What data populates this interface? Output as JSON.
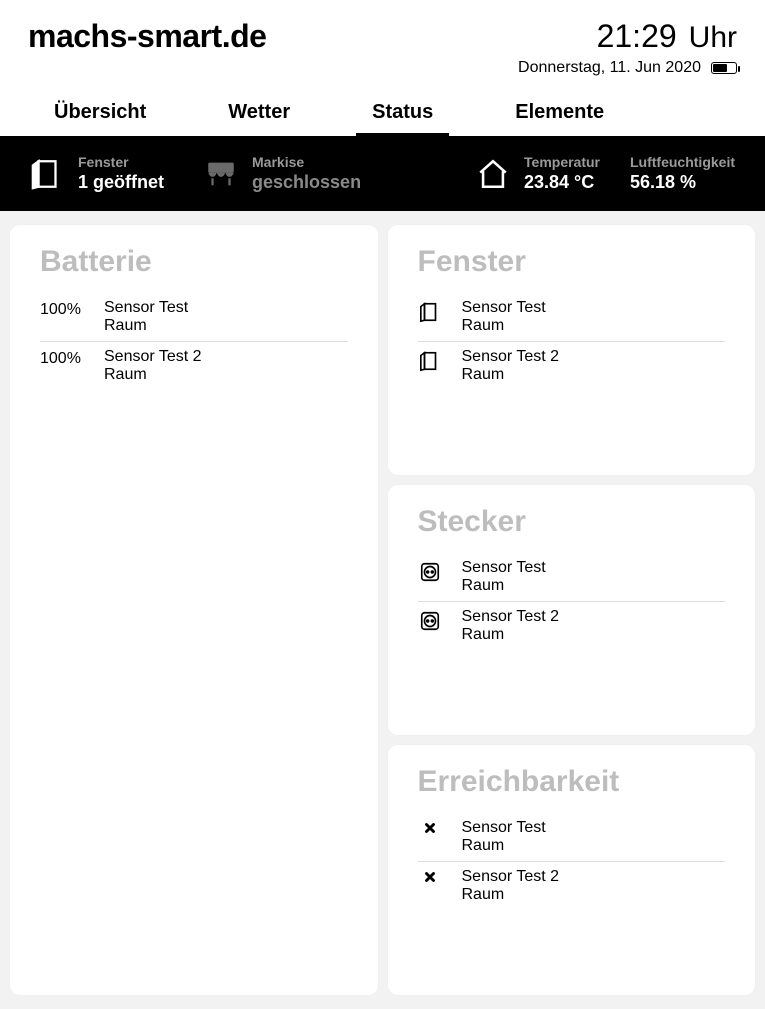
{
  "header": {
    "site_title": "machs-smart.de",
    "time": "21:29",
    "time_suffix": "Uhr",
    "date": "Donnerstag, 11. Jun 2020"
  },
  "tabs": [
    {
      "label": "Übersicht",
      "active": false
    },
    {
      "label": "Wetter",
      "active": false
    },
    {
      "label": "Status",
      "active": true
    },
    {
      "label": "Elemente",
      "active": false
    }
  ],
  "statusbar": {
    "fenster": {
      "label": "Fenster",
      "value": "1 geöffnet"
    },
    "markise": {
      "label": "Markise",
      "value": "geschlossen"
    },
    "temperatur": {
      "label": "Temperatur",
      "value": "23.84 °C"
    },
    "luftfeuchtigkeit": {
      "label": "Luftfeuchtigkeit",
      "value": "56.18 %"
    }
  },
  "cards": {
    "fenster": {
      "title": "Fenster",
      "rows": [
        {
          "name": "Sensor Test",
          "room": "Raum"
        },
        {
          "name": "Sensor Test 2",
          "room": "Raum"
        }
      ]
    },
    "batterie": {
      "title": "Batterie",
      "rows": [
        {
          "value": "100%",
          "name": "Sensor Test",
          "room": "Raum"
        },
        {
          "value": "100%",
          "name": "Sensor Test 2",
          "room": "Raum"
        }
      ]
    },
    "stecker": {
      "title": "Stecker",
      "rows": [
        {
          "name": "Sensor Test",
          "room": "Raum"
        },
        {
          "name": "Sensor Test 2",
          "room": "Raum"
        }
      ]
    },
    "erreichbarkeit": {
      "title": "Erreichbarkeit",
      "rows": [
        {
          "name": "Sensor Test",
          "room": "Raum"
        },
        {
          "name": "Sensor Test 2",
          "room": "Raum"
        }
      ]
    }
  }
}
